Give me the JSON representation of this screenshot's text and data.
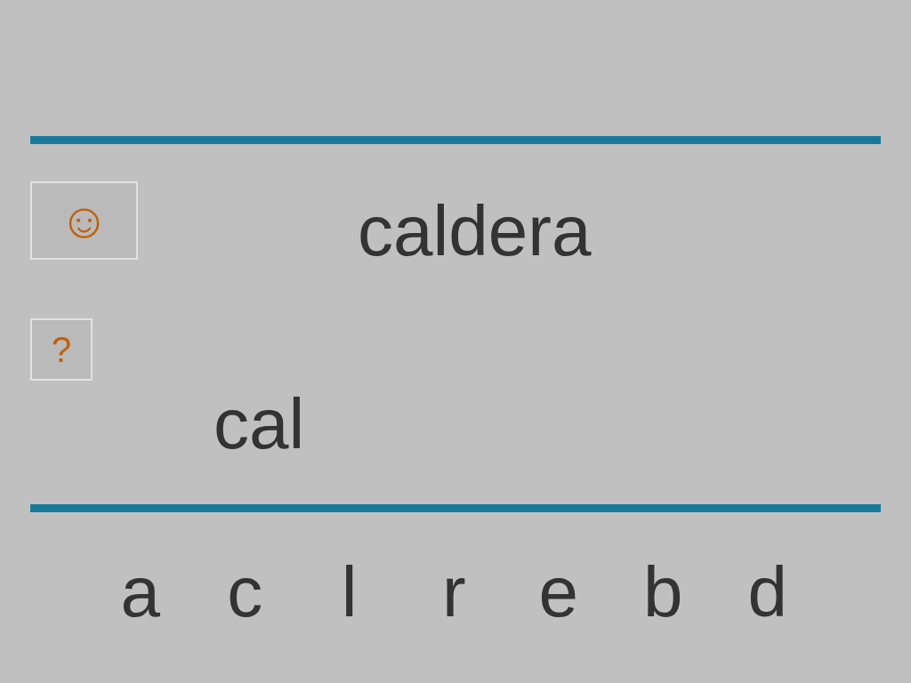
{
  "target_word": "caldera",
  "smiley_button": {
    "label": "☺"
  },
  "help_button": {
    "label": "?"
  },
  "answer": "cal",
  "letters": [
    "a",
    "c",
    "l",
    "r",
    "e",
    "b",
    "d"
  ]
}
